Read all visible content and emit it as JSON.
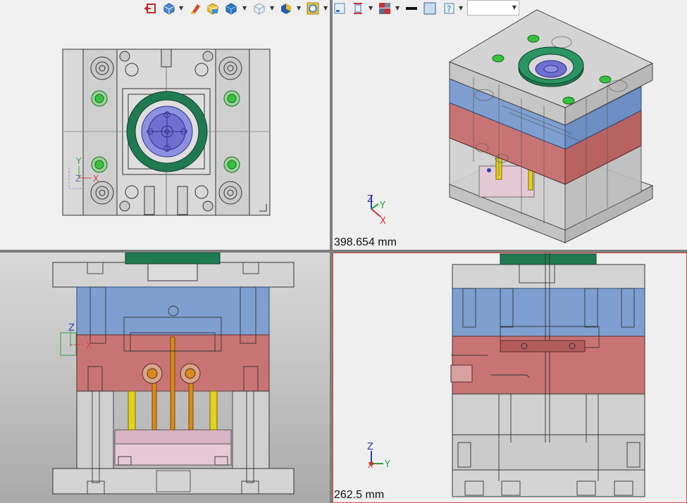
{
  "toolbar": {
    "icons": [
      "exit-sketch-icon",
      "view-orientation-icon",
      "edit-appearance-icon",
      "apply-scene-icon",
      "display-style-icon",
      "hide-show-items-icon",
      "section-view-icon",
      "view-settings-icon",
      "previous-view-icon",
      "section-plane-icon",
      "viewport-layout-icon",
      "line-color-icon",
      "face-color-icon",
      "help-icon"
    ],
    "style_select_value": ""
  },
  "viewports": {
    "top": {
      "label": "Top view",
      "triad": {
        "y": "Y",
        "z": "Z",
        "x": "X"
      }
    },
    "iso": {
      "label": "Isometric view",
      "scale_text": "398.654 mm",
      "triad": {
        "z": "Z",
        "y": "Y",
        "x": "X"
      }
    },
    "front": {
      "label": "Front view",
      "triad": {
        "z": "Z",
        "x": "X"
      }
    },
    "side": {
      "label": "Right view",
      "scale_text": "262.5 mm",
      "triad": {
        "z": "Z",
        "x": "X",
        "y": "Y"
      },
      "active": true
    }
  },
  "colors": {
    "top_plate": "#d6d6d6",
    "cavity_plate": "#7f9fd0",
    "core_plate": "#c97474",
    "locating_ring": "#1f7a52",
    "sprue_bushing": "#5a5ab8",
    "leader_pin_green": "#37c13f",
    "ejector_pin_yellow": "#e3d21c",
    "ejector_pin_orange": "#d98a1a",
    "ejector_plate": "#e7c9d6",
    "active_border": "#d94a4a"
  }
}
